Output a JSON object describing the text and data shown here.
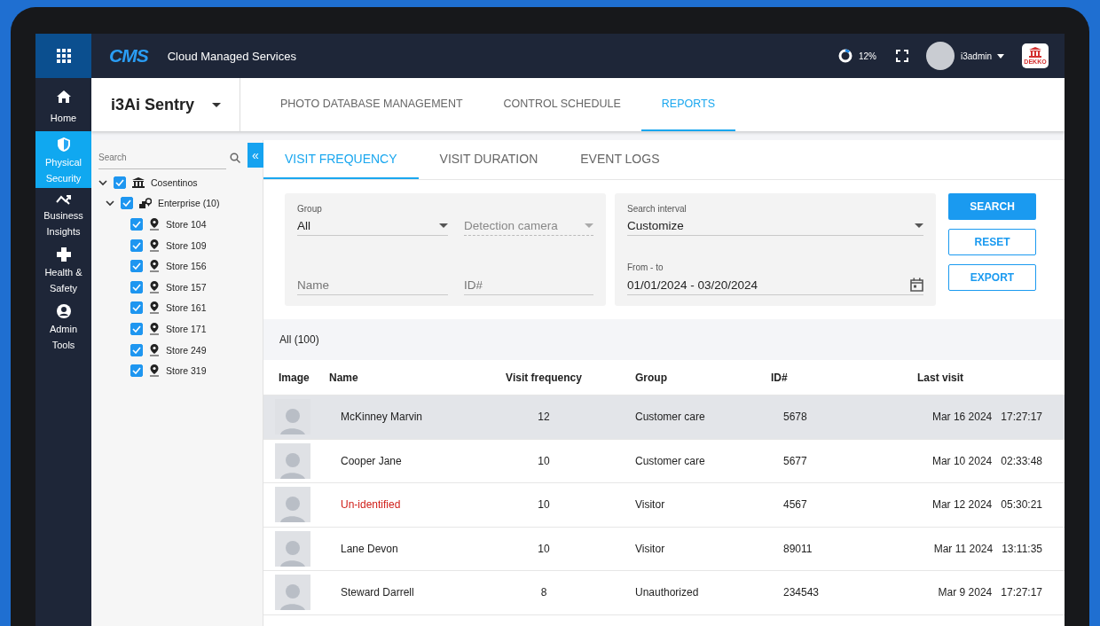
{
  "top_bar": {
    "logo": "CMS",
    "title": "Cloud Managed Services",
    "usage": {
      "text": "12%",
      "level": 0.12
    },
    "user": "i3admin",
    "brand_badge": "DEKKO"
  },
  "nav": [
    {
      "label": "Home",
      "selected": false
    },
    {
      "label": "Physical Security",
      "selected": true
    },
    {
      "label": "Business Insights",
      "selected": false
    },
    {
      "label": "Health & Safety",
      "selected": false
    },
    {
      "label": "Admin Tools",
      "selected": false
    }
  ],
  "product": "i3Ai Sentry",
  "main_tabs": [
    {
      "label": "PHOTO DATABASE MANAGEMENT",
      "selected": false
    },
    {
      "label": "CONTROL SCHEDULE",
      "selected": false
    },
    {
      "label": "REPORTS",
      "selected": true
    }
  ],
  "tree": {
    "search_placeholder": "Search",
    "collapse": "«",
    "items": [
      {
        "label": "Cosentinos",
        "kind": "org",
        "checked": true,
        "expanded": true,
        "children": [
          {
            "label": "Enterprise (10)",
            "kind": "group",
            "checked": true,
            "expanded": true,
            "children": [
              {
                "label": "Store 104",
                "kind": "store",
                "checked": true
              },
              {
                "label": "Store 109",
                "kind": "store",
                "checked": true
              },
              {
                "label": "Store 156",
                "kind": "store",
                "checked": true
              },
              {
                "label": "Store 157",
                "kind": "store",
                "checked": true
              },
              {
                "label": "Store 161",
                "kind": "store",
                "checked": true
              },
              {
                "label": "Store 171",
                "kind": "store",
                "checked": true
              },
              {
                "label": "Store 249",
                "kind": "store",
                "checked": true
              },
              {
                "label": "Store 319",
                "kind": "store",
                "checked": true
              }
            ]
          }
        ]
      }
    ]
  },
  "report_tabs": [
    {
      "label": "VISIT FREQUENCY",
      "selected": true
    },
    {
      "label": "VISIT DURATION",
      "selected": false
    },
    {
      "label": "EVENT LOGS",
      "selected": false
    }
  ],
  "filters": {
    "group": {
      "label": "Group",
      "value": "All"
    },
    "camera": {
      "placeholder": "Detection camera",
      "disabled": true
    },
    "name": {
      "placeholder": "Name"
    },
    "id": {
      "placeholder": "ID#"
    },
    "interval": {
      "label": "Search interval",
      "value": "Customize"
    },
    "range": {
      "label": "From - to",
      "value": "01/01/2024 - 03/20/2024"
    }
  },
  "buttons": [
    {
      "label": "SEARCH",
      "kind": "primary"
    },
    {
      "label": "RESET",
      "kind": "outline"
    },
    {
      "label": "EXPORT",
      "kind": "outline"
    }
  ],
  "result_count": "All (100)",
  "table": {
    "columns": [
      "Image",
      "Name",
      "Visit frequency",
      "Group",
      "ID#",
      "Last visit"
    ],
    "rows": [
      {
        "name": "McKinney Marvin",
        "identified": true,
        "selected": true,
        "frequency": "12",
        "group": "Customer care",
        "id": "5678",
        "last_visit": "Mar 16 2024   17:27:17"
      },
      {
        "name": "Cooper Jane",
        "identified": true,
        "selected": false,
        "frequency": "10",
        "group": "Customer care",
        "id": "5677",
        "last_visit": "Mar 10 2024   02:33:48"
      },
      {
        "name": "Un-identified",
        "identified": false,
        "selected": false,
        "frequency": "10",
        "group": "Visitor",
        "id": "4567",
        "last_visit": "Mar 12 2024   05:30:21"
      },
      {
        "name": "Lane Devon",
        "identified": true,
        "selected": false,
        "frequency": "10",
        "group": "Visitor",
        "id": "89011",
        "last_visit": "Mar 11 2024   13:11:35"
      },
      {
        "name": "Steward Darrell",
        "identified": true,
        "selected": false,
        "frequency": "8",
        "group": "Unauthorized",
        "id": "234543",
        "last_visit": "Mar 9 2024   17:27:17"
      }
    ]
  }
}
